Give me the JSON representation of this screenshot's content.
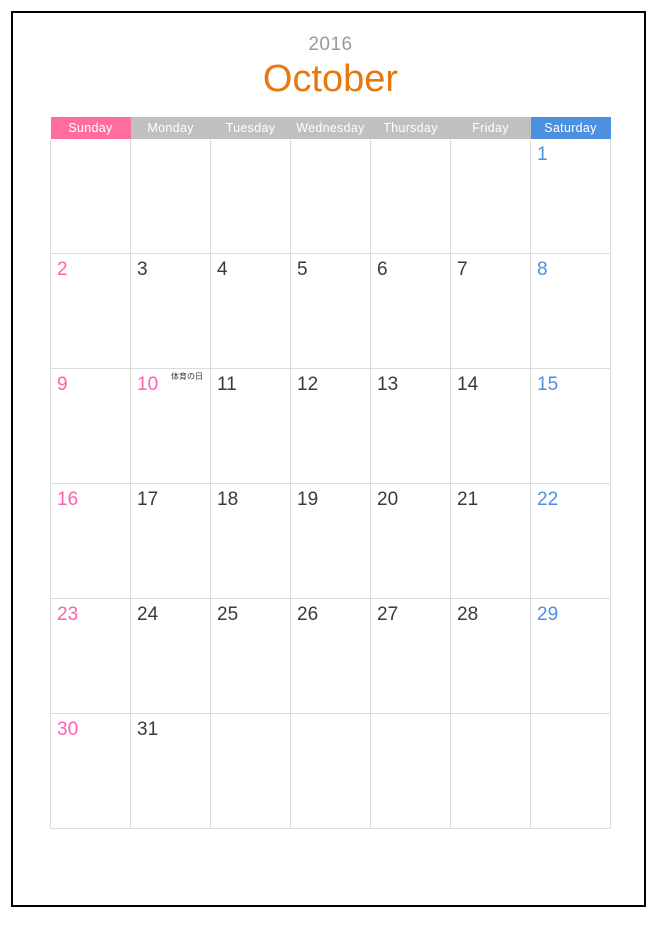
{
  "calendar": {
    "year": "2016",
    "month": "October",
    "colors": {
      "month_accent": "#E8770D",
      "year_text": "#9A9A9A",
      "sunday_header_bg": "#FF6D9E",
      "saturday_header_bg": "#4D90E0",
      "weekday_header_bg": "#C0C0C0",
      "sunday_text": "#FF5FB0",
      "saturday_text": "#4D90E0",
      "weekday_text": "#3A3A3A",
      "grid_line": "#DCDCDC",
      "page_border": "#000000"
    },
    "weekday_headers": [
      {
        "label": "Sunday",
        "kind": "sunday"
      },
      {
        "label": "Monday",
        "kind": "weekday"
      },
      {
        "label": "Tuesday",
        "kind": "weekday"
      },
      {
        "label": "Wednesday",
        "kind": "weekday"
      },
      {
        "label": "Thursday",
        "kind": "weekday"
      },
      {
        "label": "Friday",
        "kind": "weekday"
      },
      {
        "label": "Saturday",
        "kind": "saturday"
      }
    ],
    "weeks": [
      [
        {
          "day": "",
          "kind": "empty"
        },
        {
          "day": "",
          "kind": "empty"
        },
        {
          "day": "",
          "kind": "empty"
        },
        {
          "day": "",
          "kind": "empty"
        },
        {
          "day": "",
          "kind": "empty"
        },
        {
          "day": "",
          "kind": "empty"
        },
        {
          "day": "1",
          "kind": "sat"
        }
      ],
      [
        {
          "day": "2",
          "kind": "sun"
        },
        {
          "day": "3",
          "kind": "weekday"
        },
        {
          "day": "4",
          "kind": "weekday"
        },
        {
          "day": "5",
          "kind": "weekday"
        },
        {
          "day": "6",
          "kind": "weekday"
        },
        {
          "day": "7",
          "kind": "weekday"
        },
        {
          "day": "8",
          "kind": "sat"
        }
      ],
      [
        {
          "day": "9",
          "kind": "sun"
        },
        {
          "day": "10",
          "kind": "holiday",
          "event": "体育の日"
        },
        {
          "day": "11",
          "kind": "weekday"
        },
        {
          "day": "12",
          "kind": "weekday"
        },
        {
          "day": "13",
          "kind": "weekday"
        },
        {
          "day": "14",
          "kind": "weekday"
        },
        {
          "day": "15",
          "kind": "sat"
        }
      ],
      [
        {
          "day": "16",
          "kind": "sun"
        },
        {
          "day": "17",
          "kind": "weekday"
        },
        {
          "day": "18",
          "kind": "weekday"
        },
        {
          "day": "19",
          "kind": "weekday"
        },
        {
          "day": "20",
          "kind": "weekday"
        },
        {
          "day": "21",
          "kind": "weekday"
        },
        {
          "day": "22",
          "kind": "sat"
        }
      ],
      [
        {
          "day": "23",
          "kind": "sun"
        },
        {
          "day": "24",
          "kind": "weekday"
        },
        {
          "day": "25",
          "kind": "weekday"
        },
        {
          "day": "26",
          "kind": "weekday"
        },
        {
          "day": "27",
          "kind": "weekday"
        },
        {
          "day": "28",
          "kind": "weekday"
        },
        {
          "day": "29",
          "kind": "sat"
        }
      ],
      [
        {
          "day": "30",
          "kind": "sun"
        },
        {
          "day": "31",
          "kind": "weekday"
        },
        {
          "day": "",
          "kind": "empty"
        },
        {
          "day": "",
          "kind": "empty"
        },
        {
          "day": "",
          "kind": "empty"
        },
        {
          "day": "",
          "kind": "empty"
        },
        {
          "day": "",
          "kind": "empty"
        }
      ]
    ]
  }
}
